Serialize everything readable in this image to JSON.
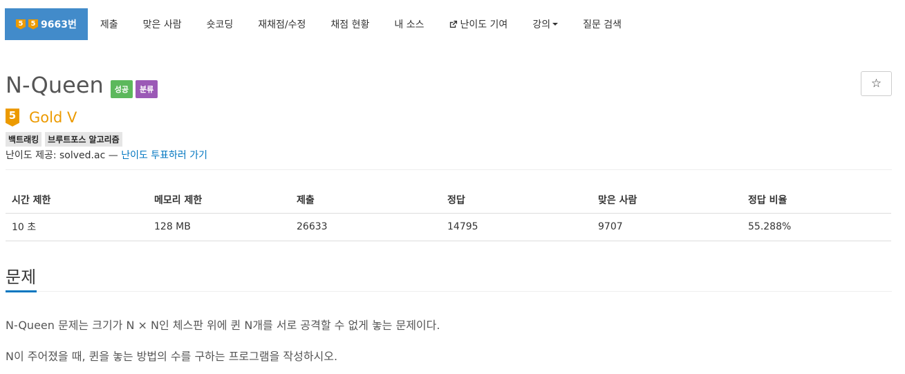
{
  "nav": {
    "active_tier_badges": [
      "5",
      "5"
    ],
    "active_label": "9663번",
    "items": [
      "제출",
      "맞은 사람",
      "숏코딩",
      "재채점/수정",
      "채점 현황",
      "내 소스",
      "난이도 기여",
      "강의",
      "질문 검색"
    ],
    "external_icon": "external-link-icon"
  },
  "problem": {
    "title": "N-Queen",
    "labels": [
      "성공",
      "분류"
    ],
    "label_colors": [
      "#5cb85c",
      "#9b59b6"
    ],
    "star_icon": "☆",
    "tier_number": "5",
    "tier_name": "Gold V",
    "tier_color": "#ec9a00",
    "tags": [
      "백트래킹",
      "브루트포스 알고리즘"
    ],
    "provider_prefix": "난이도 제공: solved.ac —",
    "provider_link": "난이도 투표하러 가기"
  },
  "info_table": {
    "headers": [
      "시간 제한",
      "메모리 제한",
      "제출",
      "정답",
      "맞은 사람",
      "정답 비율"
    ],
    "values": [
      "10 초",
      "128 MB",
      "26633",
      "14795",
      "9707",
      "55.288%"
    ]
  },
  "section": {
    "title": "문제",
    "accent_color": "#0076c0",
    "paragraphs": [
      "N-Queen 문제는 크기가 N × N인 체스판 위에 퀸 N개를 서로 공격할 수 없게 놓는 문제이다.",
      "N이 주어졌을 때, 퀸을 놓는 방법의 수를 구하는 프로그램을 작성하시오."
    ]
  }
}
